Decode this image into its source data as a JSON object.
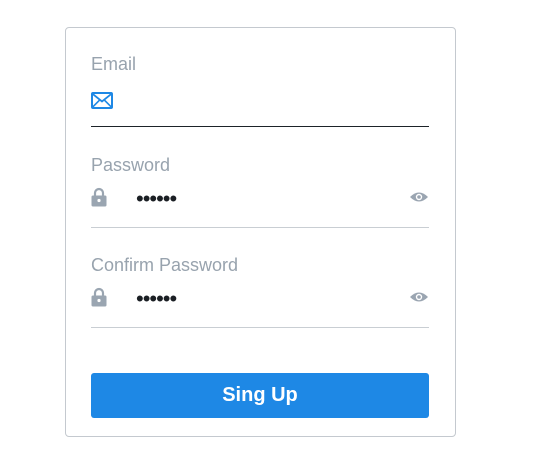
{
  "form": {
    "email": {
      "label": "Email",
      "icon": "envelope-icon",
      "value": ""
    },
    "password": {
      "label": "Password",
      "icon": "lock-icon",
      "value": "••••••",
      "toggle_icon": "eye-icon"
    },
    "confirm_password": {
      "label": "Confirm Password",
      "icon": "lock-icon",
      "value": "••••••",
      "toggle_icon": "eye-icon"
    },
    "submit_label": "Sing Up"
  },
  "colors": {
    "accent": "#1e88e5",
    "label": "#98a3ae",
    "icon": "#9aa5b1",
    "envelope": "#1e88e5"
  }
}
